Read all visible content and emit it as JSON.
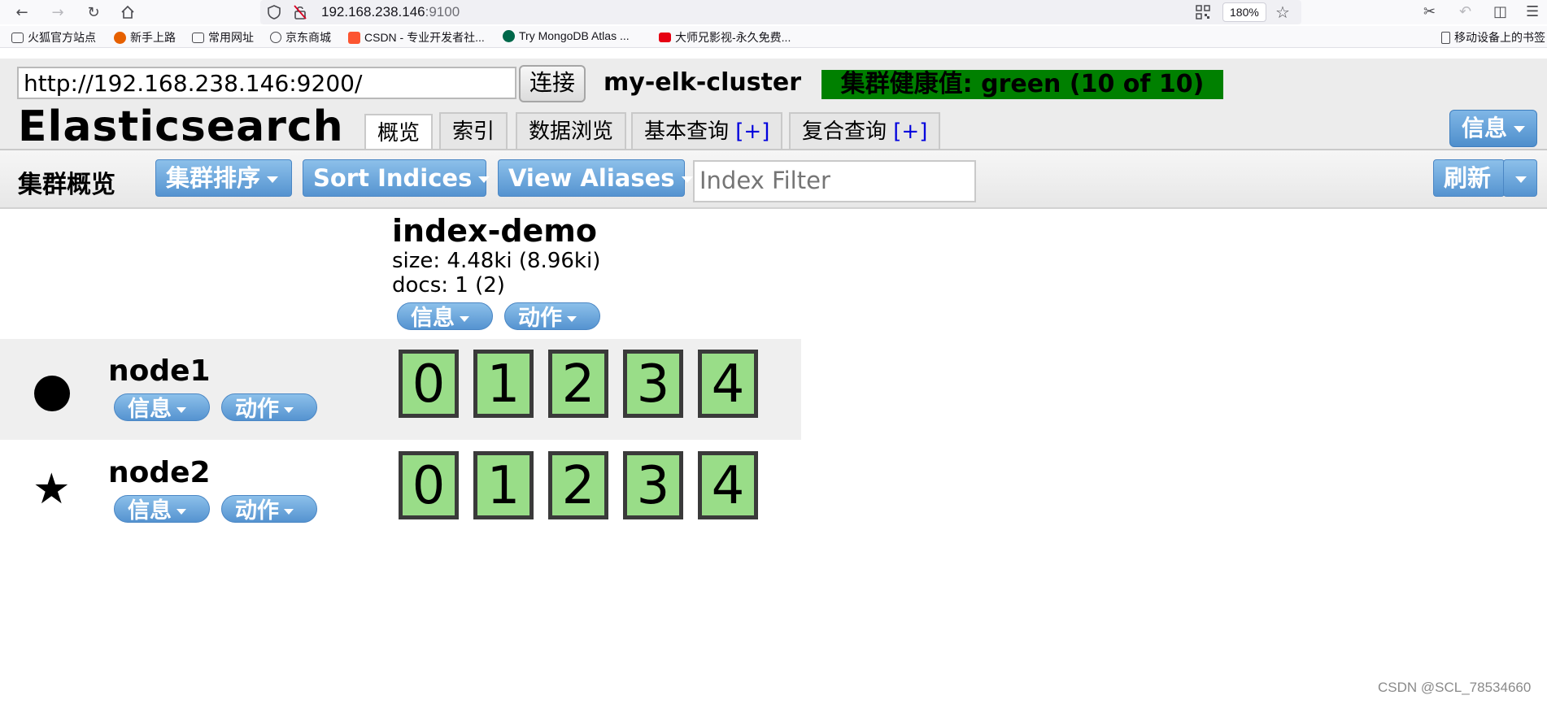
{
  "browser": {
    "url_host": "192.168.238.146",
    "url_port": ":9100",
    "zoom": "180%",
    "bookmarks": [
      {
        "label": "火狐官方站点",
        "color": "#ffffff"
      },
      {
        "label": "新手上路",
        "color": "#e66000"
      },
      {
        "label": "常用网址",
        "color": "#ffffff"
      },
      {
        "label": "京东商城",
        "color": "#ffffff"
      },
      {
        "label": "CSDN - 专业开发者社...",
        "color": "#fc5531"
      },
      {
        "label": "Try MongoDB Atlas ...",
        "color": "#00684a"
      },
      {
        "label": "大师兄影视-永久免费...",
        "color": "#e60012"
      }
    ],
    "mobile_bookmarks": "移动设备上的书签"
  },
  "app": {
    "connection_url": "http://192.168.238.146:9200/",
    "connect_label": "连接",
    "cluster_name": "my-elk-cluster",
    "health_text": "集群健康值: green (10 of 10)",
    "health_color": "#008000",
    "title": "Elasticsearch",
    "tabs": [
      {
        "label": "概览",
        "plus": ""
      },
      {
        "label": "索引",
        "plus": ""
      },
      {
        "label": "数据浏览",
        "plus": ""
      },
      {
        "label": "基本查询 ",
        "plus": "[+]"
      },
      {
        "label": "复合查询 ",
        "plus": "[+]"
      }
    ],
    "info_label": "信息"
  },
  "toolbar": {
    "title": "集群概览",
    "cluster_sort_label": "集群排序",
    "sort_indices_label": "Sort Indices",
    "view_aliases_label": "View Aliases",
    "filter_placeholder": "Index Filter",
    "refresh_label": "刷新"
  },
  "index": {
    "name": "index-demo",
    "size": "size: 4.48ki (8.96ki)",
    "docs": "docs: 1 (2)",
    "info_label": "信息",
    "action_label": "动作"
  },
  "nodes": [
    {
      "name": "node1",
      "info_label": "信息",
      "action_label": "动作",
      "shards": [
        "0",
        "1",
        "2",
        "3",
        "4"
      ]
    },
    {
      "name": "node2",
      "info_label": "信息",
      "action_label": "动作",
      "shards": [
        "0",
        "1",
        "2",
        "3",
        "4"
      ]
    }
  ],
  "shard_color": "#99dd88",
  "watermark": "CSDN @SCL_78534660"
}
